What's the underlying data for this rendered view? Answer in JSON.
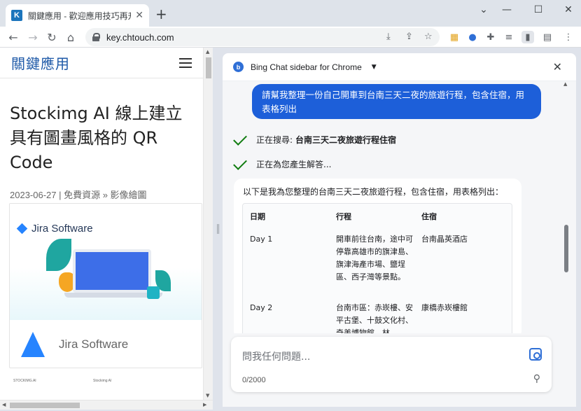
{
  "browser": {
    "tab_title": "關鍵應用 - 歡迎應用技巧再升級",
    "tab_favicon": "K",
    "tab_close": "✕",
    "new_tab": "+",
    "url": "key.chtouch.com",
    "window": {
      "minimize": "—",
      "maximize": "☐",
      "close": "✕",
      "chevron": "⌄"
    },
    "nav": {
      "back": "←",
      "forward": "→",
      "reload": "↻",
      "home": "⌂"
    }
  },
  "page": {
    "site_logo": "關鍵應用",
    "post_title": "Stockimg AI 線上建立具有圖畫風格的 QR Code",
    "post_meta": "2023-06-27 | 免費資源 » 影像繪圖",
    "card_top_brand": "Jira Software",
    "card_bottom_brand": "Jira Software",
    "thumb_texts": [
      "STOCKIMG.AI",
      "Stockimg AI"
    ]
  },
  "sidebar": {
    "icon_letter": "b",
    "title": "Bing Chat sidebar for Chrome",
    "user_message": "請幫我整理一份自己開車到台南三天二夜的旅遊行程，包含住宿，用表格列出",
    "status_searching_prefix": "正在搜尋:",
    "status_searching_query": "台南三天二夜旅遊行程住宿",
    "status_generating": "正在為您產生解答...",
    "answer_intro": "以下是我為您整理的台南三天二夜旅遊行程，包含住宿，用表格列出：",
    "table": {
      "headers": [
        "日期",
        "行程",
        "住宿"
      ],
      "rows": [
        [
          "Day 1",
          "開車前往台南，途中可停靠高雄市的旗津島、旗津海產市場、鹽埕區、西子灣等景點。",
          "台南晶英酒店"
        ],
        [
          "Day 2",
          "台南市區：赤崁樓、安平古堡、十鼓文化村、奇美博物館、林",
          "康橋赤崁樓館"
        ]
      ]
    },
    "input_placeholder": "問我任何問題...",
    "char_counter": "0/2000"
  }
}
